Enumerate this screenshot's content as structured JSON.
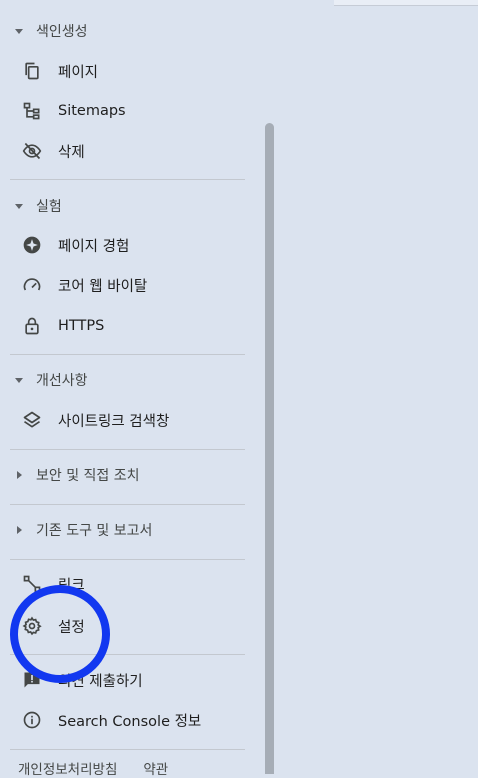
{
  "sections": {
    "indexing": {
      "label": "색인생성"
    },
    "experience": {
      "label": "실험"
    },
    "enhancements": {
      "label": "개선사항"
    },
    "security": {
      "label": "보안 및 직접 조치"
    },
    "legacy": {
      "label": "기존 도구 및 보고서"
    }
  },
  "items": {
    "pages": "페이지",
    "sitemaps": "Sitemaps",
    "removals": "삭제",
    "page_experience": "페이지 경험",
    "core_web_vitals": "코어 웹 바이탈",
    "https": "HTTPS",
    "sitelinks_searchbox": "사이트링크 검색창",
    "links": "링크",
    "settings": "설정",
    "feedback": "의견 제출하기",
    "about": "Search Console 정보"
  },
  "footer": {
    "privacy": "개인정보처리방침",
    "terms": "약관"
  },
  "colors": {
    "background": "#dbe3ef",
    "highlight": "#1238f0"
  }
}
